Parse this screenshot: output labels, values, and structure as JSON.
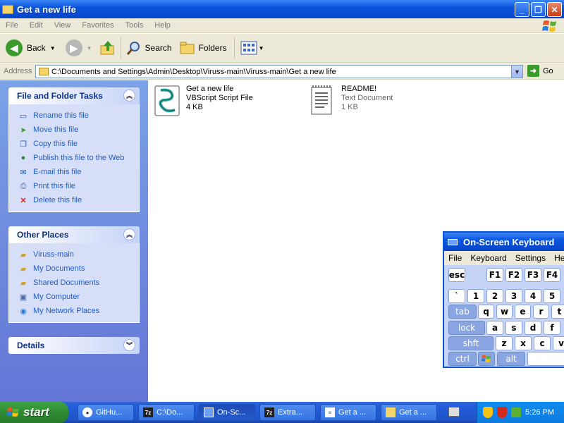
{
  "window": {
    "title": "Get a new life",
    "menu": [
      "File",
      "Edit",
      "View",
      "Favorites",
      "Tools",
      "Help"
    ],
    "toolbar": {
      "back": "Back",
      "search": "Search",
      "folders": "Folders"
    },
    "address": {
      "label": "Address",
      "value": "C:\\Documents and Settings\\Admin\\Desktop\\Viruss-main\\Viruss-main\\Get a new life",
      "go": "Go"
    }
  },
  "sidebar": {
    "file_tasks": {
      "title": "File and Folder Tasks",
      "items": [
        {
          "label": "Rename this file",
          "icon": "rename-icon"
        },
        {
          "label": "Move this file",
          "icon": "move-icon"
        },
        {
          "label": "Copy this file",
          "icon": "copy-icon"
        },
        {
          "label": "Publish this file to the Web",
          "icon": "publish-icon"
        },
        {
          "label": "E-mail this file",
          "icon": "email-icon"
        },
        {
          "label": "Print this file",
          "icon": "print-icon"
        },
        {
          "label": "Delete this file",
          "icon": "delete-icon"
        }
      ]
    },
    "other_places": {
      "title": "Other Places",
      "items": [
        {
          "label": "Viruss-main",
          "icon": "folder-icon"
        },
        {
          "label": "My Documents",
          "icon": "folder-icon"
        },
        {
          "label": "Shared Documents",
          "icon": "folder-icon"
        },
        {
          "label": "My Computer",
          "icon": "computer-icon"
        },
        {
          "label": "My Network Places",
          "icon": "network-icon"
        }
      ]
    },
    "details": {
      "title": "Details"
    }
  },
  "files": [
    {
      "name": "Get a new life",
      "type": "VBScript Script File",
      "size": "4 KB",
      "icon": "vbscript-icon"
    },
    {
      "name": "README!",
      "type": "Text Document",
      "size": "1 KB",
      "icon": "text-document-icon"
    }
  ],
  "osk": {
    "title": "On-Screen Keyboard",
    "menu": [
      "File",
      "Keyboard",
      "Settings",
      "Help"
    ],
    "rows": {
      "fn": [
        "esc",
        "F1",
        "F2",
        "F3",
        "F4"
      ],
      "num": [
        "`",
        "1",
        "2",
        "3",
        "4",
        "5"
      ],
      "tab": [
        "tab",
        "q",
        "w",
        "e",
        "r",
        "t"
      ],
      "caps": [
        "lock",
        "a",
        "s",
        "d",
        "f"
      ],
      "shift": [
        "shft",
        "z",
        "x",
        "c",
        "v"
      ],
      "bottom": [
        "ctrl",
        "alt"
      ]
    }
  },
  "taskbar": {
    "start": "start",
    "tasks": [
      {
        "label": "GitHu...",
        "icon": "browser-icon"
      },
      {
        "label": "C:\\Do...",
        "icon": "7zip-icon"
      },
      {
        "label": "On-Sc...",
        "icon": "keyboard-icon"
      },
      {
        "label": "Extra...",
        "icon": "7zip-icon"
      },
      {
        "label": "Get a ...",
        "icon": "document-icon"
      },
      {
        "label": "Get a ...",
        "icon": "folder-icon"
      }
    ],
    "clock": "5:26 PM"
  },
  "colors": {
    "xp_blue": "#0a55dd",
    "sidebar_link": "#215dc6",
    "start_green": "#3ea443"
  }
}
